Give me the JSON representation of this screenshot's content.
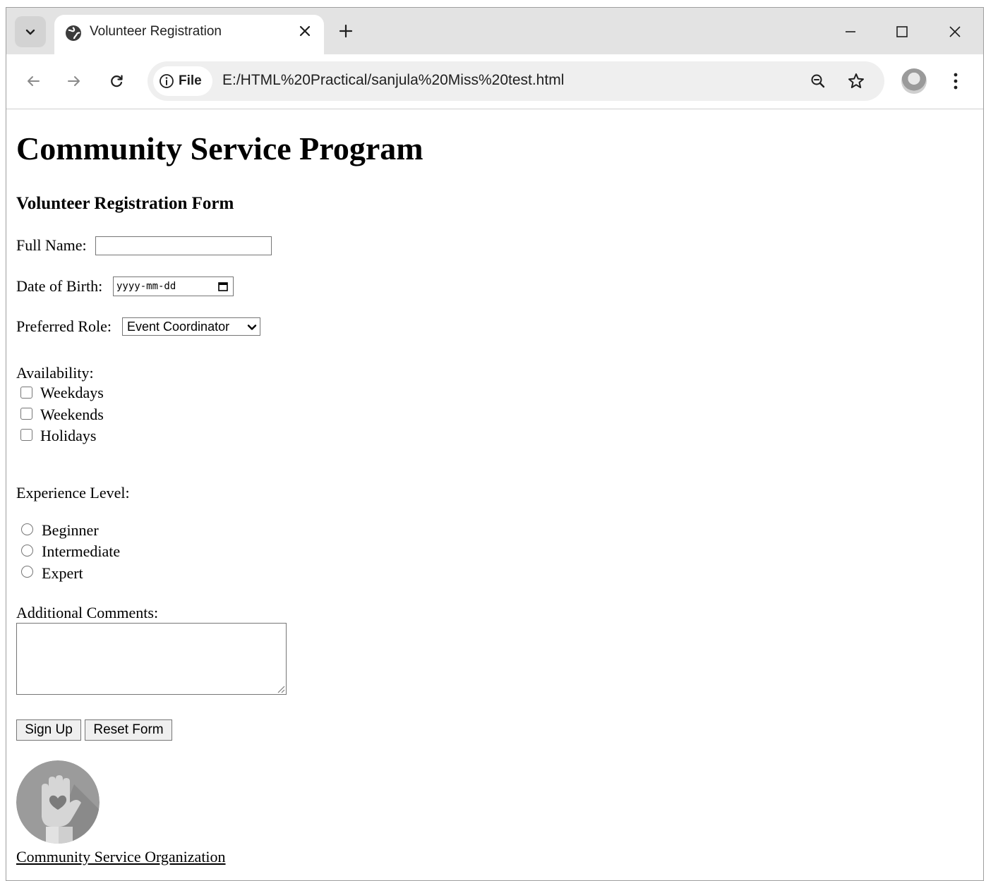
{
  "browser": {
    "tab": {
      "title": "Volunteer Registration",
      "favicon_icon": "globe-icon"
    },
    "new_tab_label": "+",
    "url_chip_label": "File",
    "url": "E:/HTML%20Practical/sanjula%20Miss%20test.html"
  },
  "page": {
    "title": "Community Service Program",
    "subtitle": "Volunteer Registration Form",
    "fields": {
      "full_name_label": "Full Name:",
      "full_name_value": "",
      "dob_label": "Date of Birth:",
      "dob_placeholder": "yyyy-mm-dd",
      "role_label": "Preferred Role:",
      "role_selected": "Event Coordinator"
    },
    "availability": {
      "label": "Availability:",
      "options": [
        "Weekdays",
        "Weekends",
        "Holidays"
      ]
    },
    "experience": {
      "label": "Experience Level:",
      "options": [
        "Beginner",
        "Intermediate",
        "Expert"
      ]
    },
    "comments_label": "Additional Comments:",
    "buttons": {
      "submit": "Sign Up",
      "reset": "Reset Form"
    },
    "footer_link": "Community Service Organization"
  }
}
